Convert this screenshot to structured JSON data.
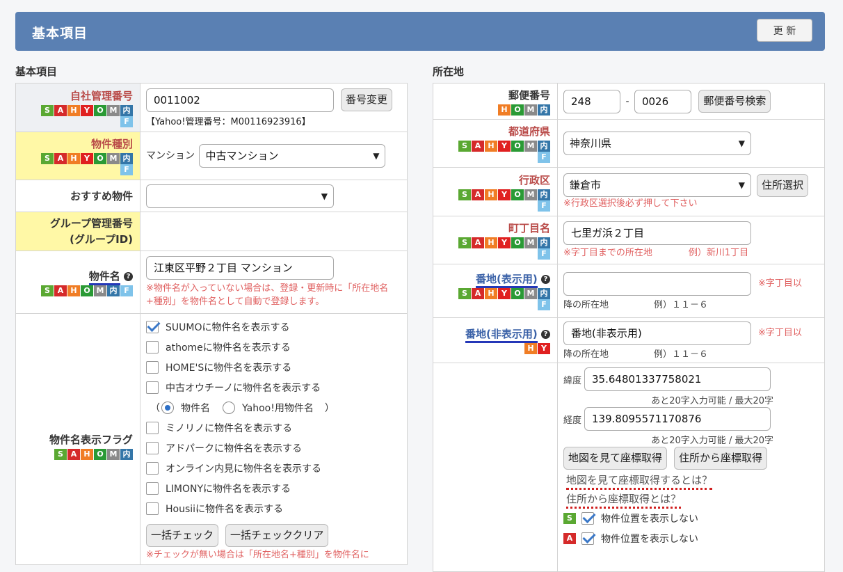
{
  "header": {
    "title": "基本項目",
    "update_label": "更 新"
  },
  "left": {
    "section": "基本項目",
    "mgmt_no": {
      "label": "自社管理番号",
      "value": "0011002",
      "btn": "番号変更",
      "note": "【Yahoo!管理番号：M00116923916】"
    },
    "prop_type": {
      "label": "物件種別",
      "prefix": "マンション",
      "value": "中古マンション"
    },
    "recommend": {
      "label": "おすすめ物件",
      "value": ""
    },
    "group": {
      "label1": "グループ管理番号",
      "label2": "(グループID)"
    },
    "prop_name": {
      "label": "物件名",
      "value": "江東区平野２丁目 マンション",
      "note": "※物件名が入っていない場合は、登録・更新時に「所在地名+種別」を物件名として自動で登録します。"
    },
    "flag": {
      "label": "物件名表示フラグ",
      "items": [
        "SUUMOに物件名を表示する",
        "athomeに物件名を表示する",
        "HOME'Sに物件名を表示する",
        "中古オウチーノに物件名を表示する"
      ],
      "radio_open": "（",
      "radio1": "物件名",
      "radio2": "Yahoo!用物件名",
      "radio_close": "）",
      "items2": [
        "ミノリノに物件名を表示する",
        "アドパークに物件名を表示する",
        "オンライン内見に物件名を表示する",
        "LIMONYに物件名を表示する",
        "Housiiに物件名を表示する"
      ],
      "btn_check": "一括チェック",
      "btn_clear": "一括チェッククリア",
      "note": "※チェックが無い場合は「所在地名+種別」を物件名に"
    }
  },
  "right": {
    "section": "所在地",
    "zip": {
      "label": "郵便番号",
      "v1": "248",
      "sep": "-",
      "v2": "0026",
      "btn": "郵便番号検索"
    },
    "pref": {
      "label": "都道府県",
      "value": "神奈川県"
    },
    "city": {
      "label": "行政区",
      "value": "鎌倉市",
      "btn": "住所選択",
      "note": "※行政区選択後必ず押して下さい"
    },
    "town": {
      "label": "町丁目名",
      "value": "七里ガ浜２丁目",
      "note": "※字丁目までの所在地　　　　例）新川1丁目"
    },
    "banchi": {
      "label": "番地(表示用)",
      "value": "",
      "note_a": "※字丁目以",
      "note_b": "降の所在地　　　　　例）１１－６"
    },
    "banchi2": {
      "label": "番地(非表示用)",
      "value": "番地(非表示用)",
      "note_a": "※字丁目以",
      "note_b": "降の所在地　　　　　例）１１－６"
    },
    "coords": {
      "lat_label": "緯度",
      "lat": "35.64801337758021",
      "lat_note": "あと20字入力可能 / 最大20字",
      "lng_label": "経度",
      "lng": "139.8095571170876",
      "lng_note": "あと20字入力可能 / 最大20字",
      "btn_map": "地図を見て座標取得",
      "btn_addr": "住所から座標取得",
      "link_map": "地図を見て座標取得するとは？",
      "link_addr": "住所から座標取得とは？",
      "hide1": "物件位置を表示しない",
      "hide2": "物件位置を表示しない"
    }
  },
  "colors": {
    "header": "#5a80b3",
    "label_red": "#b94a48",
    "label_blue": "#3b62a8",
    "yellow_bg": "#fff8a6"
  }
}
